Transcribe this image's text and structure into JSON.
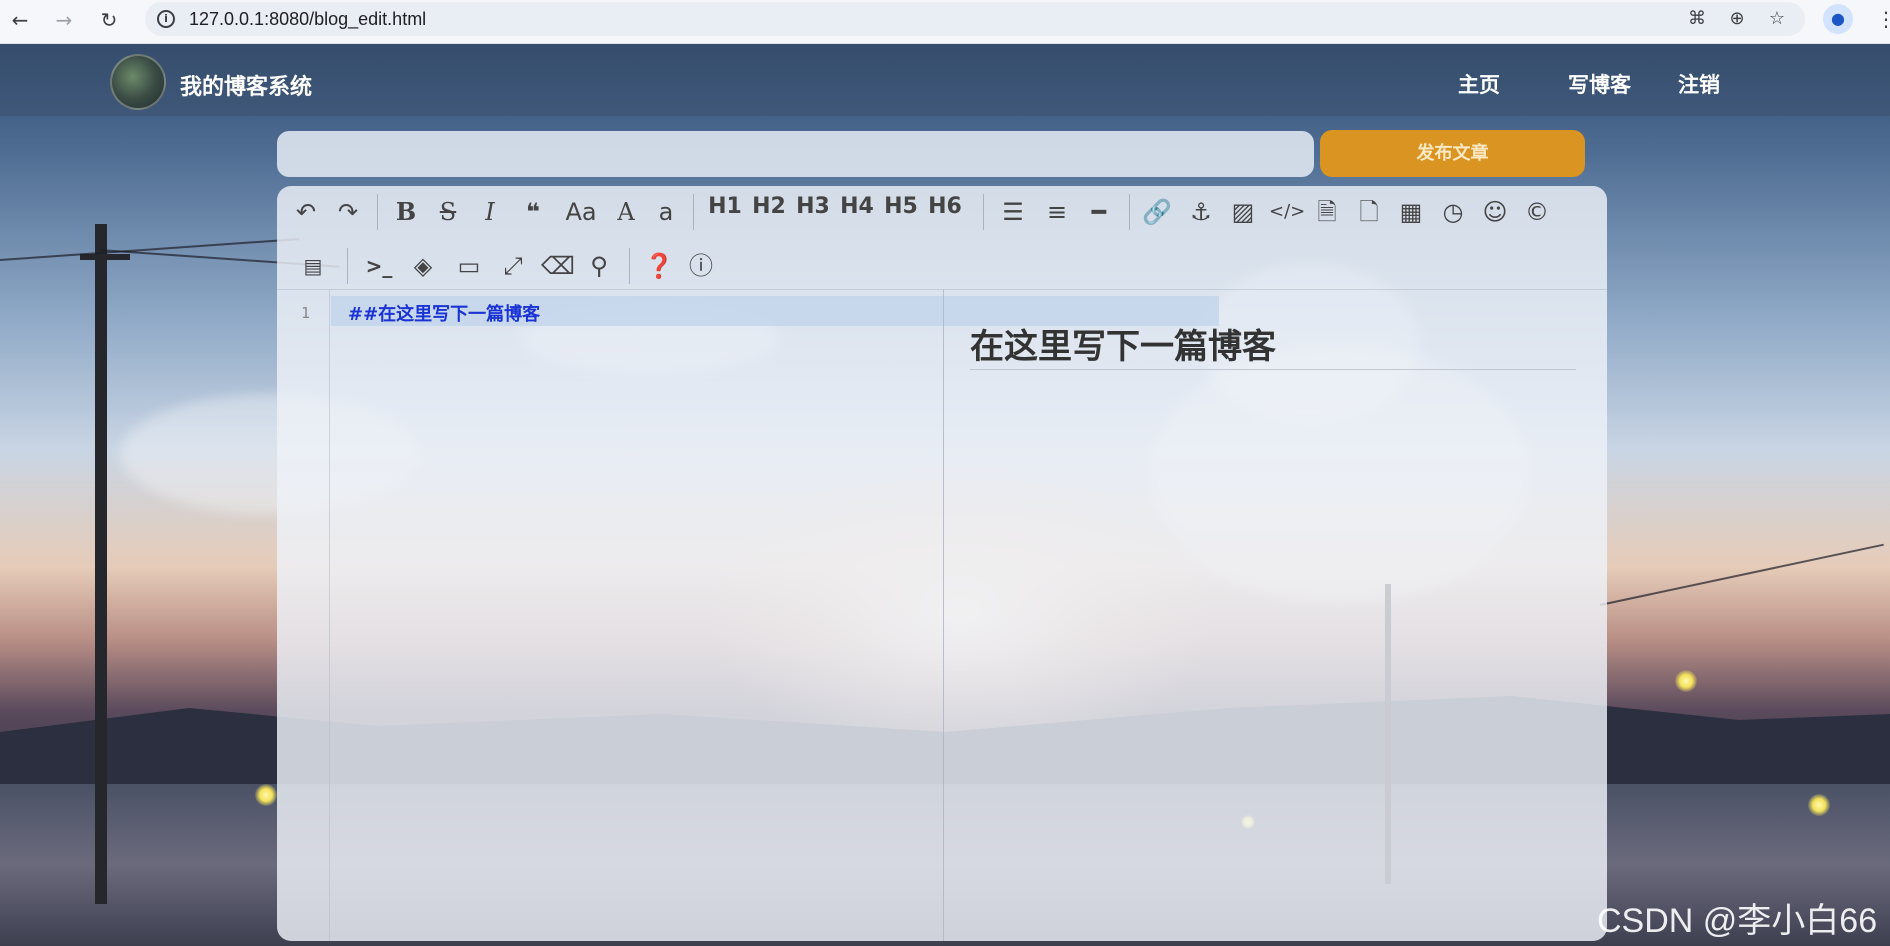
{
  "browser": {
    "url": "127.0.0.1:8080/blog_edit.html"
  },
  "site": {
    "title": "我的博客系统",
    "nav": [
      {
        "label": "主页"
      },
      {
        "label": "写博客"
      },
      {
        "label": "注销"
      }
    ]
  },
  "editor": {
    "publish_label": "发布文章",
    "title_value": "",
    "toolbar_row1": [
      "undo-icon",
      "redo-icon",
      "bold-icon",
      "strikethrough-icon",
      "italic-icon",
      "quote-icon",
      "uppercase-icon",
      "uppercase-first-icon",
      "lowercase-icon",
      "H1",
      "H2",
      "H3",
      "H4",
      "H5",
      "H6",
      "unordered-list-icon",
      "ordered-list-icon",
      "hr-icon",
      "link-icon",
      "anchor-icon",
      "image-icon",
      "code-icon",
      "preformatted-code-icon",
      "code-block-icon",
      "table-icon",
      "datetime-icon",
      "emoji-icon",
      "html-entities-icon"
    ],
    "toolbar_row2": [
      "watch-icon",
      "terminal-icon",
      "unwatch-icon",
      "fullscreen-preview-icon",
      "fullscreen-icon",
      "clear-icon",
      "search-icon",
      "help-icon",
      "info-icon"
    ],
    "headings": {
      "h1": "H1",
      "h2": "H2",
      "h3": "H3",
      "h4": "H4",
      "h5": "H5",
      "h6": "H6"
    },
    "line_number": "1",
    "code_line": "##在这里写下一篇博客",
    "preview_heading": "在这里写下一篇博客"
  },
  "watermark": "CSDN @李小白66",
  "colors": {
    "publish_button": "#d99422",
    "code_text": "#1a33d4"
  }
}
